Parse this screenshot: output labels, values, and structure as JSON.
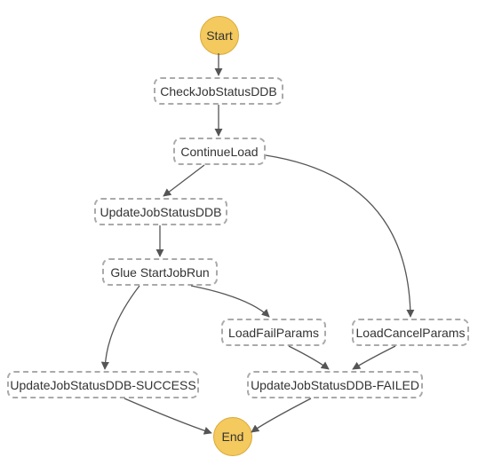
{
  "nodes": {
    "start": {
      "label": "Start"
    },
    "check": {
      "label": "CheckJobStatusDDB"
    },
    "continue": {
      "label": "ContinueLoad"
    },
    "update": {
      "label": "UpdateJobStatusDDB"
    },
    "glue": {
      "label": "Glue StartJobRun"
    },
    "loadfail": {
      "label": "LoadFailParams"
    },
    "loadcancel": {
      "label": "LoadCancelParams"
    },
    "success": {
      "label": "UpdateJobStatusDDB-SUCCESS"
    },
    "failed": {
      "label": "UpdateJobStatusDDB-FAILED"
    },
    "end": {
      "label": "End"
    }
  },
  "edges": [
    [
      "start",
      "check"
    ],
    [
      "check",
      "continue"
    ],
    [
      "continue",
      "update"
    ],
    [
      "continue",
      "loadcancel"
    ],
    [
      "update",
      "glue"
    ],
    [
      "glue",
      "success"
    ],
    [
      "glue",
      "loadfail"
    ],
    [
      "loadfail",
      "failed"
    ],
    [
      "loadcancel",
      "failed"
    ],
    [
      "success",
      "end"
    ],
    [
      "failed",
      "end"
    ]
  ]
}
